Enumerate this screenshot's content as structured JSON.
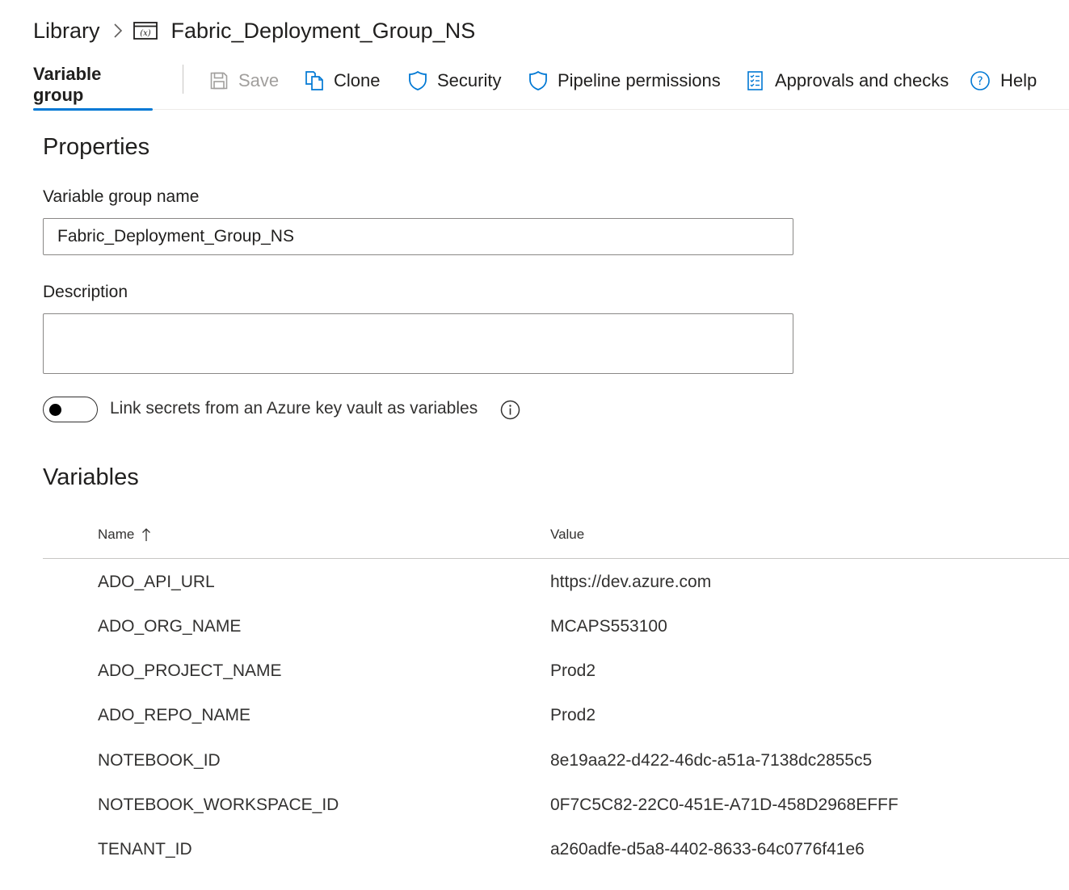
{
  "breadcrumb": {
    "library": "Library",
    "current": "Fabric_Deployment_Group_NS"
  },
  "toolbar": {
    "active_tab": "Variable group",
    "save": "Save",
    "clone": "Clone",
    "security": "Security",
    "pipeline_permissions": "Pipeline permissions",
    "approvals": "Approvals and checks",
    "help": "Help"
  },
  "properties": {
    "title": "Properties",
    "name_label": "Variable group name",
    "name_value": "Fabric_Deployment_Group_NS",
    "description_label": "Description",
    "description_value": "",
    "keyvault_toggle_label": "Link secrets from an Azure key vault as variables",
    "keyvault_toggle_on": false
  },
  "variables": {
    "title": "Variables",
    "columns": {
      "name": "Name",
      "value": "Value"
    },
    "sort": "ascending",
    "rows": [
      {
        "name": "ADO_API_URL",
        "value": "https://dev.azure.com"
      },
      {
        "name": "ADO_ORG_NAME",
        "value": "MCAPS553100"
      },
      {
        "name": "ADO_PROJECT_NAME",
        "value": "Prod2"
      },
      {
        "name": "ADO_REPO_NAME",
        "value": "Prod2"
      },
      {
        "name": "NOTEBOOK_ID",
        "value": "8e19aa22-d422-46dc-a51a-7138dc2855c5"
      },
      {
        "name": "NOTEBOOK_WORKSPACE_ID",
        "value": "0F7C5C82-22C0-451E-A71D-458D2968EFFF"
      },
      {
        "name": "TENANT_ID",
        "value": "a260adfe-d5a8-4402-8633-64c0776f41e6"
      }
    ]
  },
  "colors": {
    "accent": "#0078d4",
    "text": "#201f1e",
    "disabled": "#a19f9d",
    "border": "#8a8886"
  },
  "icons": [
    "chevron-right-icon",
    "variable-group-icon",
    "save-icon",
    "clone-icon",
    "shield-icon",
    "approvals-icon",
    "help-icon",
    "info-icon",
    "sort-ascending-icon"
  ]
}
